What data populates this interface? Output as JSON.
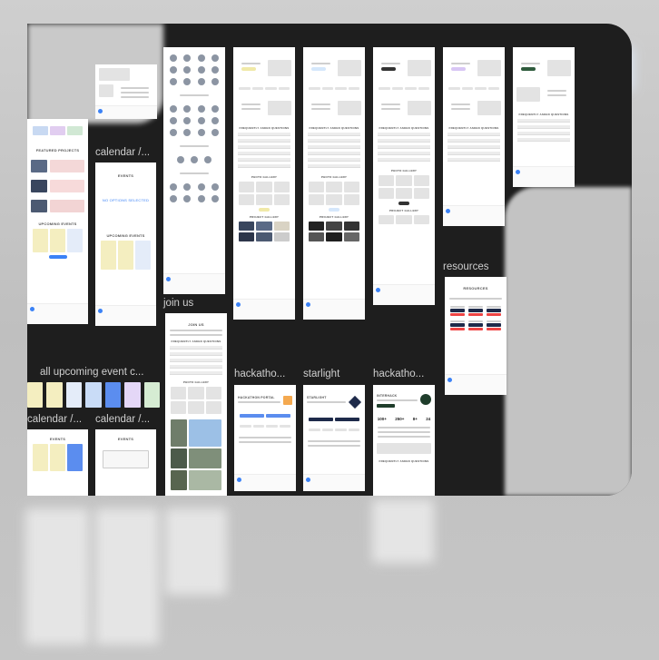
{
  "canvas_labels": {
    "calendar_1": "calendar /...",
    "join_us": "join us",
    "resources": "resources",
    "all_upcoming": "all upcoming event c...",
    "calendar_2": "calendar /...",
    "calendar_3": "calendar /...",
    "hackathon_1": "hackatho...",
    "starlight": "starlight",
    "hackathon_2": "hackatho..."
  },
  "frame_text": {
    "featured_projects": "FEATURED PROJECTS",
    "upcoming_events": "UPCOMING EVENTS",
    "upcoming_events_2": "UPCOMING EVENTS",
    "events": "EVENTS",
    "events_2": "EVENTS",
    "events_3": "EVENTS",
    "no_options": "NO OPTIONS SELECTED",
    "join_us": "JOIN US",
    "faq": "FREQUENTLY ASKED QUESTIONS",
    "photo_gallery": "PHOTO GALLERY",
    "project_gallery": "PROJECT GALLERY",
    "resources": "RESOURCES",
    "hackathon_portal": "HACKATHON PORTAL",
    "starlight": "STARLIGHT",
    "interhack": "INTERHACK",
    "stats": [
      "100+",
      "250+",
      "8+",
      "24"
    ]
  },
  "colors": {
    "canvas": "#1e1e1e",
    "backdrop": "#bdbdbd",
    "accent_blue": "#3b82f6",
    "event_yellow": "#f4eec0"
  }
}
